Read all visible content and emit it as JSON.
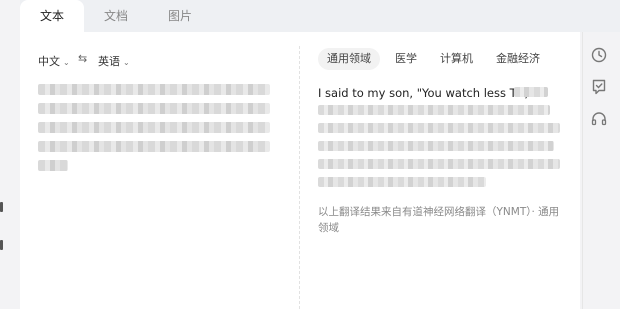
{
  "tabs": [
    {
      "label": "文本"
    },
    {
      "label": "文档"
    },
    {
      "label": "图片"
    }
  ],
  "source": {
    "lang_from": "中文",
    "lang_to": "英语"
  },
  "domains": [
    {
      "label": "通用领域"
    },
    {
      "label": "医学"
    },
    {
      "label": "计算机"
    },
    {
      "label": "金融经济"
    }
  ],
  "translation": {
    "first_line": "I said to my son, \"You watch less TV,"
  },
  "footer": "以上翻译结果来自有道神经网络翻译（YNMT）· 通用领域",
  "icons": [
    "swap-icon",
    "history-icon",
    "feedback-icon",
    "headset-icon"
  ]
}
